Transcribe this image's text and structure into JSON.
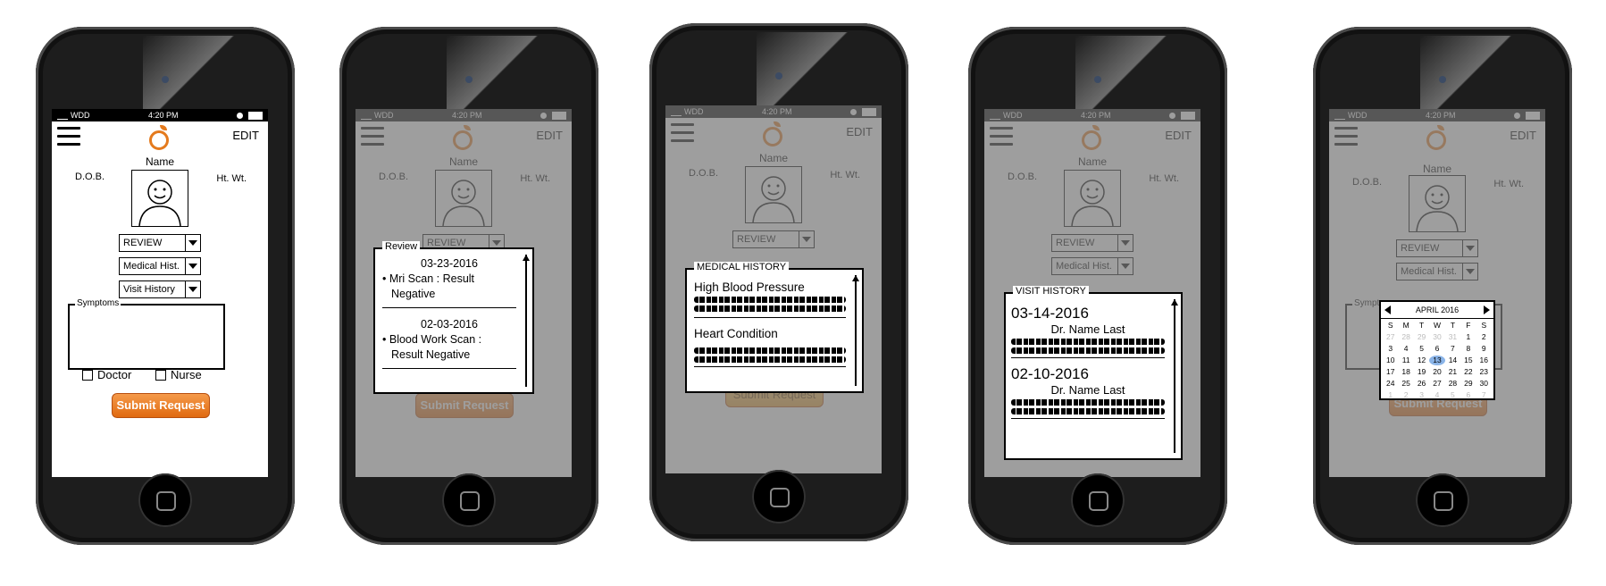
{
  "status": {
    "carrier": "WDD",
    "time": "4:20 PM"
  },
  "header": {
    "edit_label": "EDIT"
  },
  "profile": {
    "name": "Name",
    "dob": "D.O.B.",
    "htwt": "Ht. Wt."
  },
  "dropdowns": {
    "review": "REVIEW",
    "medical": "Medical Hist.",
    "visit": "Visit History"
  },
  "symptoms": {
    "legend": "Symptoms"
  },
  "checks": {
    "doctor": "Doctor",
    "nurse": "Nurse"
  },
  "submit_label": "Submit Request",
  "review_popup": {
    "legend": "Review",
    "entries": [
      {
        "date": "03-23-2016",
        "line1": "Mri Scan : Result",
        "line2": "Negative"
      },
      {
        "date": "02-03-2016",
        "line1": "Blood Work Scan :",
        "line2": "Result Negative"
      }
    ]
  },
  "medical_popup": {
    "legend": "MEDICAL HISTORY",
    "items": [
      "High Blood Pressure",
      "Heart Condition"
    ]
  },
  "visit_popup": {
    "legend": "VISIT HISTORY",
    "visits": [
      {
        "date": "03-14-2016",
        "doctor": "Dr. Name Last"
      },
      {
        "date": "02-10-2016",
        "doctor": "Dr. Name Last"
      }
    ]
  },
  "calendar": {
    "month": "APRIL 2016",
    "weekdays": [
      "S",
      "M",
      "T",
      "W",
      "T",
      "F",
      "S"
    ],
    "rows": [
      [
        "27",
        "28",
        "29",
        "30",
        "31",
        "1",
        "2"
      ],
      [
        "3",
        "4",
        "5",
        "6",
        "7",
        "8",
        "9"
      ],
      [
        "10",
        "11",
        "12",
        "13",
        "14",
        "15",
        "16"
      ],
      [
        "17",
        "18",
        "19",
        "20",
        "21",
        "22",
        "23"
      ],
      [
        "24",
        "25",
        "26",
        "27",
        "28",
        "29",
        "30"
      ],
      [
        "1",
        "2",
        "3",
        "4",
        "5",
        "6",
        "7"
      ]
    ],
    "selected": "13"
  },
  "colors": {
    "accent": "#e47a1d",
    "submit": "#e06a10"
  }
}
